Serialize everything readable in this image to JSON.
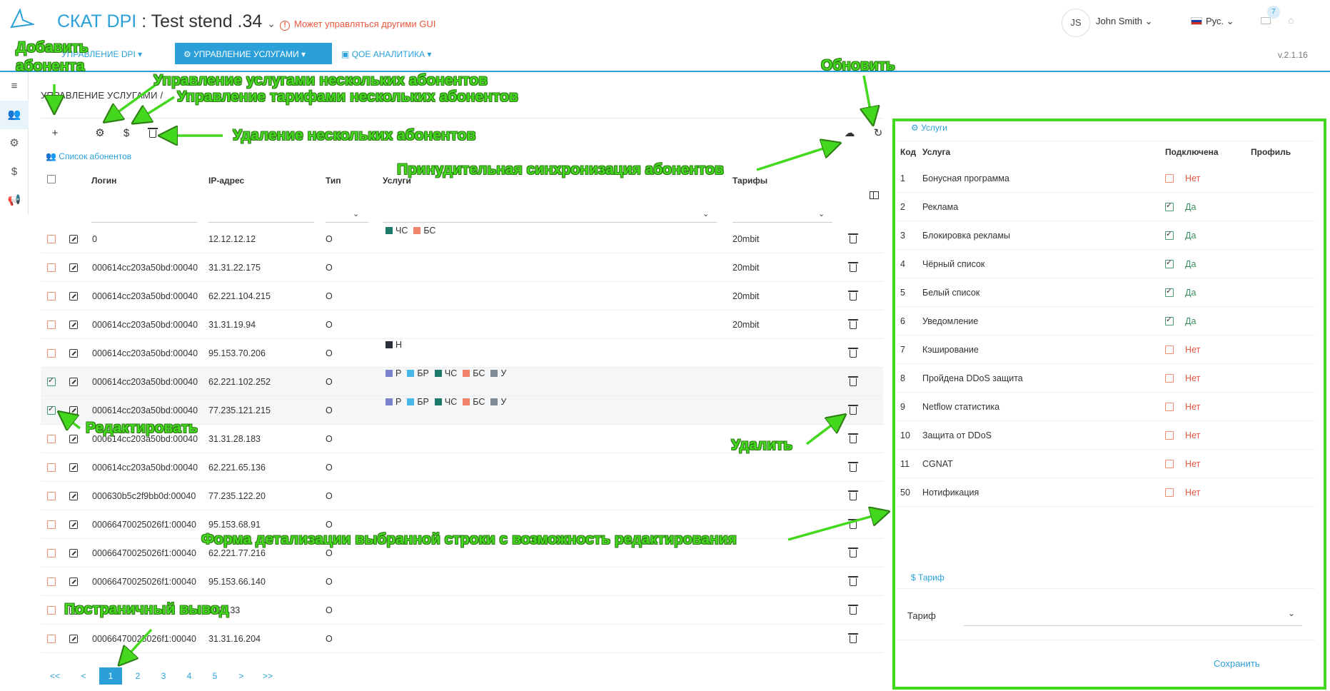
{
  "header": {
    "brand": "СКАТ DPI",
    "separator": ":",
    "stand": "Test stend .34",
    "warning": "Может управляться другими GUI",
    "user_initials": "JS",
    "user_name": "John Smith",
    "language": "Рус.",
    "notifications": "7"
  },
  "nav": {
    "items": [
      {
        "label": "Управление DPI"
      },
      {
        "label": "Управление услугами"
      },
      {
        "label": "QoE аналитика"
      }
    ],
    "version": "v.2.1.16"
  },
  "page": {
    "title": "Управление услугами /",
    "list_title": "Список абонентов"
  },
  "table": {
    "columns": [
      "Логин",
      "IP-адрес",
      "Тип",
      "Услуги",
      "Тарифы"
    ],
    "rows": [
      {
        "checked": false,
        "login": "0",
        "ip": "12.12.12.12",
        "type": "O",
        "services": [
          {
            "label": "ЧС",
            "color": "#1e7a6a"
          },
          {
            "label": "БС",
            "color": "#f0826a"
          }
        ],
        "tariff": "20mbit"
      },
      {
        "checked": false,
        "login": "000614cc203a50bd:00040",
        "ip": "31.31.22.175",
        "type": "O",
        "services": [],
        "tariff": "20mbit"
      },
      {
        "checked": false,
        "login": "000614cc203a50bd:00040",
        "ip": "62.221.104.215",
        "type": "O",
        "services": [],
        "tariff": "20mbit"
      },
      {
        "checked": false,
        "login": "000614cc203a50bd:00040",
        "ip": "31.31.19.94",
        "type": "O",
        "services": [],
        "tariff": "20mbit"
      },
      {
        "checked": false,
        "login": "000614cc203a50bd:00040",
        "ip": "95.153.70.206",
        "type": "O",
        "services": [
          {
            "label": "Н",
            "color": "#2b2f3b"
          }
        ],
        "tariff": ""
      },
      {
        "checked": true,
        "login": "000614cc203a50bd:00040",
        "ip": "62.221.102.252",
        "type": "O",
        "services": [
          {
            "label": "Р",
            "color": "#7b82cc"
          },
          {
            "label": "БР",
            "color": "#48b8ea"
          },
          {
            "label": "ЧС",
            "color": "#1e7a6a"
          },
          {
            "label": "БС",
            "color": "#f0826a"
          },
          {
            "label": "У",
            "color": "#7f8c95"
          }
        ],
        "tariff": ""
      },
      {
        "checked": true,
        "login": "000614cc203a50bd:00040",
        "ip": "77.235.121.215",
        "type": "O",
        "services": [
          {
            "label": "Р",
            "color": "#7b82cc"
          },
          {
            "label": "БР",
            "color": "#48b8ea"
          },
          {
            "label": "ЧС",
            "color": "#1e7a6a"
          },
          {
            "label": "БС",
            "color": "#f0826a"
          },
          {
            "label": "У",
            "color": "#7f8c95"
          }
        ],
        "tariff": ""
      },
      {
        "checked": false,
        "login": "000614cc203a50bd:00040",
        "ip": "31.31.28.183",
        "type": "O",
        "services": [],
        "tariff": ""
      },
      {
        "checked": false,
        "login": "000614cc203a50bd:00040",
        "ip": "62.221.65.136",
        "type": "O",
        "services": [],
        "tariff": ""
      },
      {
        "checked": false,
        "login": "000630b5c2f9bb0d:00040",
        "ip": "77.235.122.20",
        "type": "O",
        "services": [],
        "tariff": ""
      },
      {
        "checked": false,
        "login": "00066470025026f1:00040",
        "ip": "95.153.68.91",
        "type": "O",
        "services": [],
        "tariff": ""
      },
      {
        "checked": false,
        "login": "00066470025026f1:00040",
        "ip": "62.221.77.216",
        "type": "O",
        "services": [],
        "tariff": ""
      },
      {
        "checked": false,
        "login": "00066470025026f1:00040",
        "ip": "95.153.66.140",
        "type": "O",
        "services": [],
        "tariff": ""
      },
      {
        "checked": false,
        "login": "",
        "ip": "119.133",
        "type": "O",
        "services": [],
        "tariff": ""
      },
      {
        "checked": false,
        "login": "00066470025026f1:00040",
        "ip": "31.31.16.204",
        "type": "O",
        "services": [],
        "tariff": ""
      }
    ]
  },
  "pagination": {
    "items": [
      "<<",
      "<",
      "1",
      "2",
      "3",
      "4",
      "5",
      ">",
      ">>"
    ],
    "current": "1"
  },
  "details": {
    "services_title": "Услуги",
    "columns": [
      "Код",
      "Услуга",
      "Подключена",
      "Профиль"
    ],
    "services": [
      {
        "code": "1",
        "name": "Бонусная программа",
        "on": false,
        "value": "Нет"
      },
      {
        "code": "2",
        "name": "Реклама",
        "on": true,
        "value": "Да"
      },
      {
        "code": "3",
        "name": "Блокировка рекламы",
        "on": true,
        "value": "Да"
      },
      {
        "code": "4",
        "name": "Чёрный список",
        "on": true,
        "value": "Да"
      },
      {
        "code": "5",
        "name": "Белый список",
        "on": true,
        "value": "Да"
      },
      {
        "code": "6",
        "name": "Уведомление",
        "on": true,
        "value": "Да"
      },
      {
        "code": "7",
        "name": "Кэширование",
        "on": false,
        "value": "Нет"
      },
      {
        "code": "8",
        "name": "Пройдена DDoS защита",
        "on": false,
        "value": "Нет"
      },
      {
        "code": "9",
        "name": "Netflow статистика",
        "on": false,
        "value": "Нет"
      },
      {
        "code": "10",
        "name": "Защита от DDoS",
        "on": false,
        "value": "Нет"
      },
      {
        "code": "11",
        "name": "CGNAT",
        "on": false,
        "value": "Нет"
      },
      {
        "code": "50",
        "name": "Нотификация",
        "on": false,
        "value": "Нет"
      }
    ],
    "tariff_title": "Тариф",
    "tariff_label": "Тариф",
    "save_label": "Сохранить"
  },
  "annotations": {
    "add": "Добавить абонента",
    "services_multi": "Управление услугами нескольких абонентов",
    "tariffs_multi": "Управление тарифами нескольких абонентов",
    "delete_multi": "Удаление нескольких абонентов",
    "refresh": "Обновить",
    "sync": "Принудительная синхронизация абонентов",
    "edit": "Редактировать",
    "delete": "Удалить",
    "detail_form": "Форма детализации выбранной строки с возможность редактирования",
    "paging": "Постраничный вывод"
  },
  "colors": {
    "accent": "#2ba0d8",
    "annotation": "#43d81e",
    "warning": "#e8563c",
    "yes": "#3a8f60"
  }
}
